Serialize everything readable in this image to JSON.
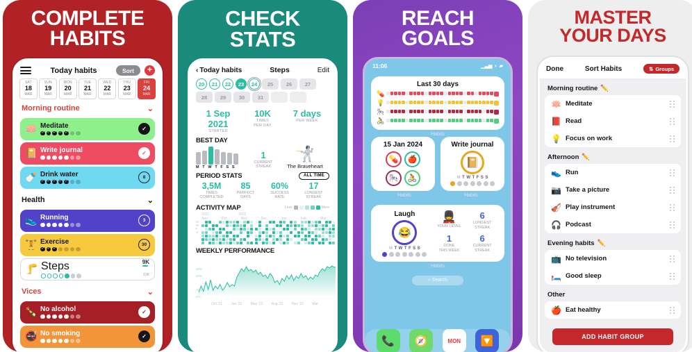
{
  "panels": [
    {
      "headline_line1": "COMPLETE",
      "headline_line2": "HABITS",
      "bg": "#b02225",
      "screen": {
        "nav": {
          "menu_icon": "hamburger-icon",
          "title": "Today habits",
          "sort_label": "Sort",
          "add_label": "+"
        },
        "days": [
          {
            "dow": "SAT",
            "num": "18",
            "mon": "MAR",
            "active": false
          },
          {
            "dow": "SUN",
            "num": "19",
            "mon": "MAR",
            "active": false
          },
          {
            "dow": "MON",
            "num": "20",
            "mon": "MAR",
            "active": false
          },
          {
            "dow": "TUE",
            "num": "21",
            "mon": "MAR",
            "active": false
          },
          {
            "dow": "WED",
            "num": "22",
            "mon": "MAR",
            "active": false
          },
          {
            "dow": "THU",
            "num": "23",
            "mon": "MAR",
            "active": false
          },
          {
            "dow": "FRI",
            "num": "24",
            "mon": "MAR",
            "active": true
          }
        ],
        "groups": [
          {
            "name": "Morning routine",
            "color": "#d9413f",
            "habits": [
              {
                "name": "Meditate",
                "emoji": "🪷",
                "bg": "#8ef08a",
                "text": "#15151a",
                "done": 5,
                "total": 7,
                "btn": "✓",
                "btn_bg": "#15151a",
                "btn_fg": "#ffffff"
              },
              {
                "name": "Write journal",
                "emoji": "📔",
                "bg": "#ef4b63",
                "text": "#ffffff",
                "done": 5,
                "total": 7,
                "btn": "✓",
                "btn_bg": "#ffffff",
                "btn_fg": "#ef4b63"
              },
              {
                "name": "Drink water",
                "emoji": "🍼",
                "bg": "#6fd9f2",
                "text": "#15151a",
                "done": 5,
                "total": 7,
                "btn": "8",
                "btn_bg": "transparent",
                "btn_fg": "#15151a"
              }
            ]
          },
          {
            "name": "Health",
            "color": "#15151a",
            "habits": [
              {
                "name": "Running",
                "emoji": "👟",
                "bg": "#5142c9",
                "text": "#ffffff",
                "done": 5,
                "total": 7,
                "btn": "3",
                "btn_bg": "transparent",
                "btn_fg": "#ffffff"
              },
              {
                "name": "Exercise",
                "emoji": "🏋️",
                "bg": "#f7c93c",
                "text": "#15151a",
                "done": 3,
                "total": 7,
                "btn": "30",
                "btn_bg": "transparent",
                "btn_fg": "#15151a"
              }
            ],
            "steps": {
              "name": "Steps",
              "emoji": "🦵",
              "value": "9K",
              "max": "10K",
              "done": 1,
              "total": 7
            }
          },
          {
            "name": "Vices",
            "color": "#d9413f",
            "habits": [
              {
                "name": "No alcohol",
                "emoji": "🍾",
                "bg": "#a51f26",
                "text": "#ffffff",
                "done": 5,
                "total": 7,
                "btn": "✓",
                "btn_bg": "#ffffff",
                "btn_fg": "#a51f26"
              },
              {
                "name": "No smoking",
                "emoji": "🚭",
                "bg": "#f1943a",
                "text": "#ffffff",
                "done": 5,
                "total": 7,
                "btn": "✓",
                "btn_bg": "#15151a",
                "btn_fg": "#ffffff"
              }
            ]
          }
        ]
      }
    },
    {
      "headline_line1": "CHECK",
      "headline_line2": "STATS",
      "bg": "#1a8a7c",
      "screen": {
        "nav": {
          "back_label": "Today habits",
          "title": "Steps",
          "edit_label": "Edit"
        },
        "calendar": [
          {
            "d": "20",
            "state": "ring"
          },
          {
            "d": "21",
            "state": "ring"
          },
          {
            "d": "22",
            "state": "ring"
          },
          {
            "d": "23",
            "state": "fill"
          },
          {
            "d": "24",
            "state": "today"
          },
          {
            "d": "25",
            "state": "dim"
          },
          {
            "d": "26",
            "state": "dim"
          },
          {
            "d": "27",
            "state": "dim"
          },
          {
            "d": "28",
            "state": "dim"
          },
          {
            "d": "29",
            "state": "dim"
          },
          {
            "d": "30",
            "state": "dim"
          },
          {
            "d": "31",
            "state": "dim"
          },
          {
            "d": "",
            "state": "blank"
          },
          {
            "d": "",
            "state": "blank"
          }
        ],
        "top_stats": [
          {
            "value": "1 Sep 2021",
            "label1": "STARTED",
            "label2": ""
          },
          {
            "value": "10K",
            "label1": "TIMES",
            "label2": "PER DAY"
          },
          {
            "value": "7 days",
            "label1": "PER WEEK",
            "label2": ""
          }
        ],
        "best_day": {
          "title": "BEST DAY",
          "dow": "M T W T F S S"
        },
        "current_streak": {
          "value": "1",
          "label1": "CURRENT",
          "label2": "STREAK"
        },
        "level_badge": {
          "emoji": "🤺",
          "name": "The Braveheart"
        },
        "period_stats": {
          "title": "PERIOD STATS",
          "filter": "ALL TIME",
          "items": [
            {
              "value": "3,5M",
              "label1": "TIMES",
              "label2": "COMPLETED"
            },
            {
              "value": "85",
              "label1": "PERFECT",
              "label2": "DAYS"
            },
            {
              "value": "60%",
              "label1": "SUCCESS",
              "label2": "RATE"
            },
            {
              "value": "17",
              "label1": "LONGEST",
              "label2": "STREAK"
            }
          ]
        },
        "activity_map": {
          "title": "ACTIVITY MAP",
          "legend_less": "Less",
          "legend_more": "More",
          "years": [
            "2021",
            "2022"
          ],
          "months": [
            "Sep",
            "Oct",
            "Nov",
            "Dec",
            "Jan",
            "Feb",
            "Mar"
          ],
          "dows": [
            "M",
            "W",
            "F",
            "S"
          ]
        },
        "weekly_performance": {
          "title": "WEEKLY PERFORMANCE",
          "ylabels": [
            "80%",
            "60%",
            "20%",
            "0%"
          ],
          "xlabels": [
            "Oct '21",
            "Jan '22",
            "May '22",
            "Aug '22",
            "Nov '22",
            "Mar"
          ]
        }
      }
    },
    {
      "headline_line1": "REACH",
      "headline_line2": "GOALS",
      "bg": "#7b3fb5",
      "screen": {
        "status": {
          "time": "11:06",
          "signal_icon": "cellular-icon",
          "wifi_icon": "wifi-icon",
          "battery_icon": "battery-icon"
        },
        "widget_last30": {
          "title": "Last 30 days",
          "footer": "Habits",
          "rows": [
            {
              "emoji": "💊",
              "color": "#e8485c"
            },
            {
              "emoji": "💡",
              "color": "#f3c431"
            },
            {
              "emoji": "🎠",
              "color": "#b52740"
            },
            {
              "emoji": "🚴",
              "color": "#4cd07a"
            }
          ]
        },
        "widget_date": {
          "title": "15 Jan 2024",
          "footer": "Habits",
          "circles": [
            {
              "emoji": "💊",
              "color": "#d63a5a"
            },
            {
              "emoji": "🍎",
              "color": "#2bbda4"
            },
            {
              "emoji": "🎠",
              "color": "#9b2d52"
            },
            {
              "emoji": "🚴",
              "color": "#4cd07a"
            }
          ]
        },
        "widget_journal": {
          "title": "Write journal",
          "emoji": "📔",
          "footer": "Habits",
          "dow": [
            "M",
            "T",
            "W",
            "T",
            "F",
            "S",
            "S"
          ],
          "done_index": 0,
          "accent": "#e3a81e"
        },
        "widget_laugh": {
          "title": "Laugh",
          "emoji": "😂",
          "footer": "Habits",
          "accent": "#5142c9",
          "dow": [
            "M",
            "T",
            "W",
            "T",
            "F",
            "S",
            "S"
          ],
          "done_index": 0,
          "level": {
            "emoji": "💂",
            "label1": "YOUR LEVEL"
          },
          "stats": [
            {
              "value": "6",
              "label1": "LONGEST",
              "label2": "STREAK"
            },
            {
              "value": "1",
              "label1": "DONE",
              "label2": "THIS WEEK"
            },
            {
              "value": "6",
              "label1": "CURRENT",
              "label2": "STREAK"
            }
          ]
        },
        "search_label": "Search",
        "dock": [
          {
            "icon": "📞",
            "bg": "#5ddb6d"
          },
          {
            "icon": "🧭",
            "bg": "#6fd96b"
          },
          {
            "icon": "MON",
            "bg": "#ffffff"
          },
          {
            "icon": "🔽",
            "bg": "#3f63d8"
          }
        ]
      }
    },
    {
      "headline_line1": "MASTER",
      "headline_line2": "YOUR DAYS",
      "bg": "#eeeeef",
      "screen": {
        "nav": {
          "done_label": "Done",
          "title": "Sort Habits",
          "groups_label": "Groups",
          "groups_icon": "sort-icon"
        },
        "sections": [
          {
            "name": "Morning routine",
            "editable": true,
            "items": [
              {
                "name": "Meditate",
                "emoji": "🪷"
              },
              {
                "name": "Read",
                "emoji": "📕"
              },
              {
                "name": "Focus on work",
                "emoji": "💡"
              }
            ]
          },
          {
            "name": "Afternoon",
            "editable": true,
            "items": [
              {
                "name": "Run",
                "emoji": "👟"
              },
              {
                "name": "Take a picture",
                "emoji": "📷"
              },
              {
                "name": "Play instrument",
                "emoji": "🎻"
              },
              {
                "name": "Podcast",
                "emoji": "🎧"
              }
            ]
          },
          {
            "name": "Evening habits",
            "editable": true,
            "items": [
              {
                "name": "No television",
                "emoji": "📺"
              },
              {
                "name": "Good sleep",
                "emoji": "🛏️"
              }
            ]
          },
          {
            "name": "Other",
            "editable": false,
            "items": [
              {
                "name": "Eat healthy",
                "emoji": "🍎"
              }
            ]
          }
        ],
        "add_button": "ADD HABIT GROUP"
      }
    }
  ],
  "chart_data": [
    {
      "type": "bar",
      "title": "BEST DAY",
      "categories": [
        "M",
        "T",
        "W",
        "T",
        "F",
        "S",
        "S"
      ],
      "values": [
        18,
        20,
        26,
        22,
        18,
        17,
        16
      ],
      "highlight_index": 2,
      "ylim": [
        0,
        28
      ],
      "xlabel": "",
      "ylabel": "",
      "grid": false
    },
    {
      "type": "area",
      "title": "WEEKLY PERFORMANCE",
      "x": [
        "Oct '21",
        "Jan '22",
        "May '22",
        "Aug '22",
        "Nov '22",
        "Mar"
      ],
      "ylim": [
        0,
        100
      ],
      "ytick_labels": [
        "0%",
        "20%",
        "60%",
        "80%"
      ],
      "values": [
        12,
        30,
        15,
        42,
        20,
        48,
        18,
        30,
        22,
        35,
        18,
        26,
        40,
        28,
        34,
        30,
        55,
        68,
        80,
        72,
        86,
        74,
        78,
        70,
        76,
        64,
        70,
        58,
        62,
        52,
        66,
        58,
        40,
        46,
        34,
        52,
        44,
        60,
        50,
        62,
        46,
        58,
        52,
        66,
        54,
        60,
        48,
        56,
        50,
        62,
        58,
        72,
        80,
        74,
        86,
        82,
        88,
        84,
        86,
        85
      ],
      "grid": false,
      "legend": "none"
    },
    {
      "type": "heatmap",
      "title": "ACTIVITY MAP",
      "xlabels": [
        "Sep",
        "Oct",
        "Nov",
        "Dec",
        "Jan",
        "Feb",
        "Mar"
      ],
      "ylabels": [
        "M",
        "W",
        "F",
        "S"
      ],
      "years": [
        "2021",
        "2022"
      ],
      "legend": [
        "Less",
        "More"
      ]
    }
  ]
}
